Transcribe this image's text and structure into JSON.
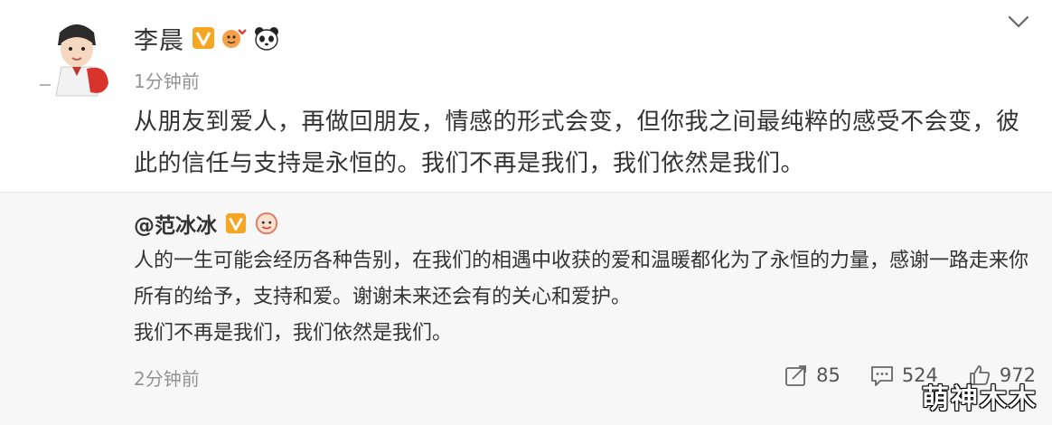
{
  "post": {
    "author": "李晨",
    "time": "1分钟前",
    "text": "从朋友到爱人，再做回朋友，情感的形式会变，但你我之间最纯粹的感受不会变，彼此的信任与支持是永恒的。我们不再是我们，我们依然是我们。"
  },
  "repost": {
    "author": "@范冰冰",
    "paragraphs": [
      "人的一生可能会经历各种告别，在我们的相遇中收获的爱和温暖都化为了永恒的力量，感谢一路走来你所有的给予，支持和爱。谢谢未来还会有的关心和爱护。",
      "我们不再是我们，我们依然是我们。"
    ],
    "time": "2分钟前",
    "actions": {
      "repost_count": "85",
      "comment_count": "524",
      "like_count": "972"
    }
  },
  "watermark": "萌神木木",
  "colors": {
    "verified_badge": "#f5a623",
    "secondary_text": "#939393",
    "repost_background": "#f7f7f7"
  }
}
